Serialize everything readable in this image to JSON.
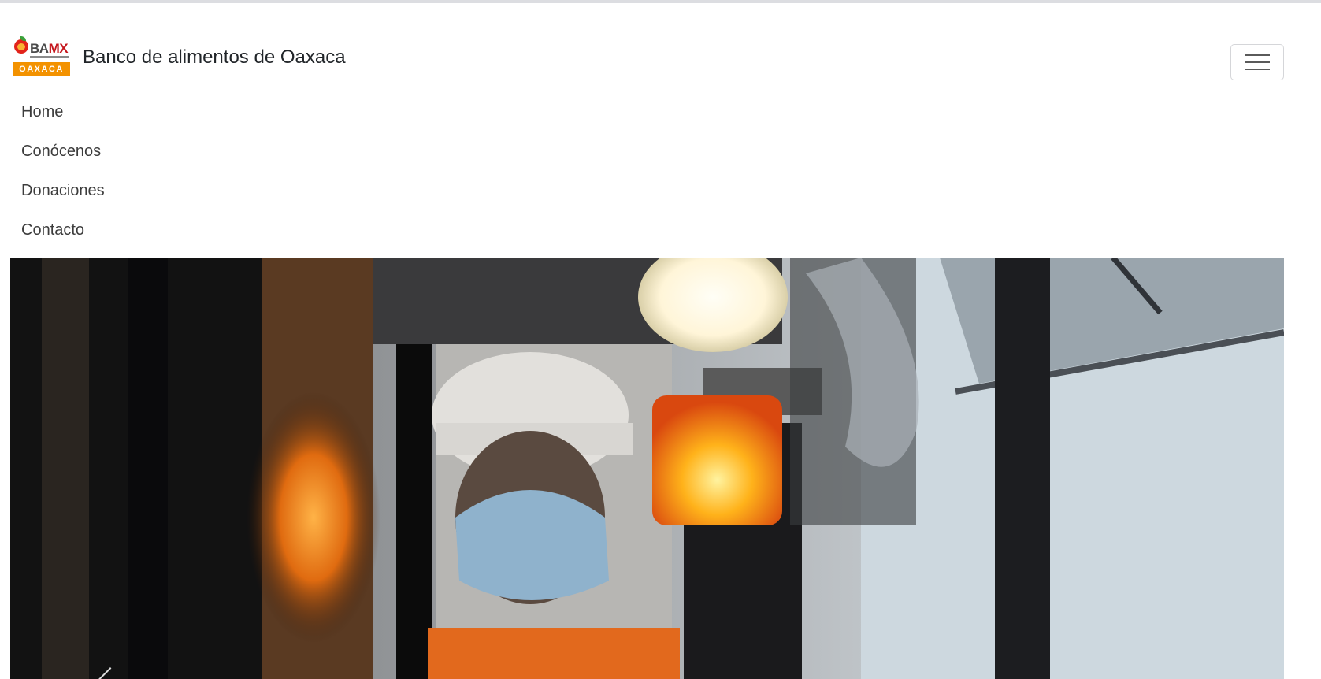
{
  "brand": {
    "logo_text_top": "BAMX",
    "logo_text_bottom": "OAXACA",
    "title": "Banco de alimentos de Oaxaca"
  },
  "navbar": {
    "toggler_icon": "hamburger-menu-icon"
  },
  "nav": {
    "items": [
      {
        "label": "Home"
      },
      {
        "label": "Conócenos"
      },
      {
        "label": "Donaciones"
      },
      {
        "label": "Contacto"
      }
    ]
  },
  "carousel": {
    "image": "forklift-worker-photo",
    "prev_icon": "chevron-left-icon"
  },
  "colors": {
    "brand_red": "#c4161c",
    "brand_orange": "#f39200",
    "text": "#212529"
  }
}
